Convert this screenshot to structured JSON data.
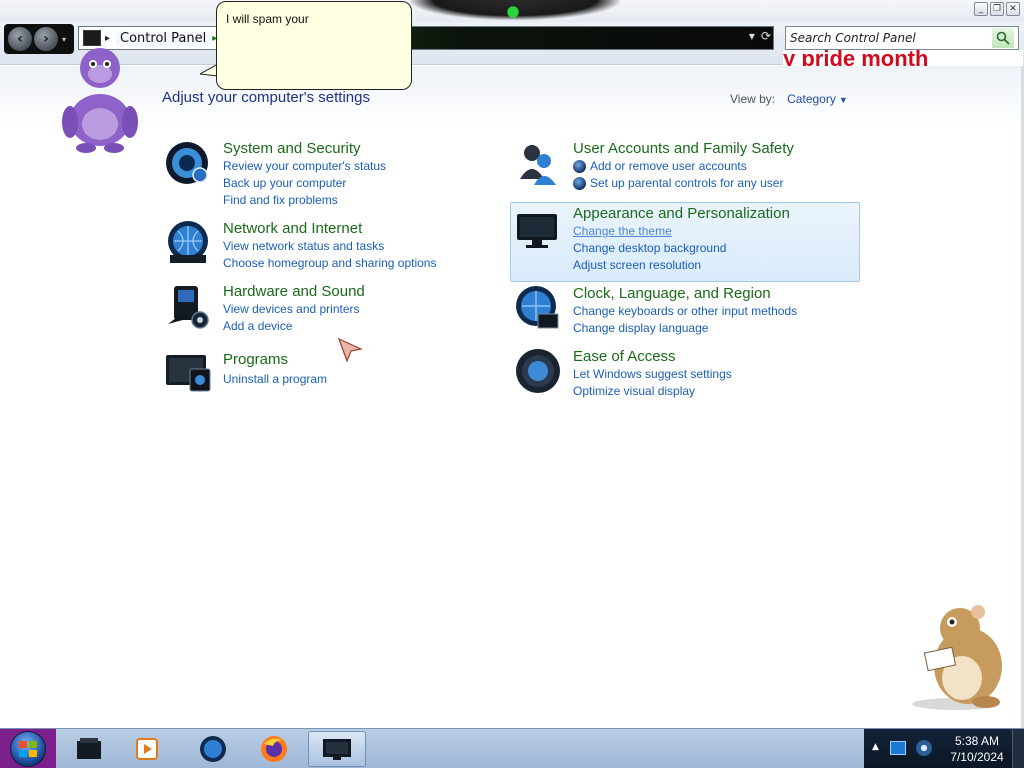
{
  "window": {
    "minimize": "_",
    "restore": "❐",
    "close": "✕"
  },
  "address": {
    "location": "Control Panel",
    "separator": "▸",
    "chevron": "▸"
  },
  "search": {
    "placeholder": "Search Control Panel"
  },
  "banner": {
    "text": "y pride month"
  },
  "page": {
    "title": "Adjust your computer's settings",
    "view_by_label": "View by:",
    "view_by_value": "Category"
  },
  "categories": [
    {
      "title": "System and Security",
      "icon": "system-security-icon",
      "links": [
        "Review your computer's status",
        "Back up your computer",
        "Find and fix problems"
      ]
    },
    {
      "title": "Network and Internet",
      "icon": "network-globe-icon",
      "links": [
        "View network status and tasks",
        "Choose homegroup and sharing options"
      ]
    },
    {
      "title": "Hardware and Sound",
      "icon": "hardware-sound-icon",
      "links": [
        "View devices and printers",
        "Add a device"
      ]
    },
    {
      "title": "Programs",
      "icon": "programs-icon",
      "links": [
        "Uninstall a program"
      ]
    },
    {
      "title": "User Accounts and Family Safety",
      "icon": "user-accounts-icon",
      "links": [
        "Add or remove user accounts",
        "Set up parental controls for any user"
      ]
    },
    {
      "title": "Appearance and Personalization",
      "icon": "monitor-icon",
      "links": [
        "Change the theme",
        "Change desktop background",
        "Adjust screen resolution"
      ]
    },
    {
      "title": "Clock, Language, and Region",
      "icon": "clock-globe-icon",
      "links": [
        "Change keyboards or other input methods",
        "Change display language"
      ]
    },
    {
      "title": "Ease of Access",
      "icon": "ease-of-access-icon",
      "links": [
        "Let Windows suggest settings",
        "Optimize visual display"
      ]
    }
  ],
  "bubble": {
    "text": "I will spam your"
  },
  "taskbar": {
    "items": [
      "windows-explorer-icon",
      "media-player-icon",
      "globe-icon",
      "firefox-icon",
      "control-panel-icon"
    ],
    "time": "5:38 AM",
    "date": "7/10/2024"
  },
  "colors": {
    "title_green": "#1a6b1a",
    "link_blue": "#1a5fb8",
    "heading_blue": "#1e3287",
    "highlight": "#d9ebfa",
    "start_purple": "#7a1f8c",
    "banner_red": "#d10a1e"
  }
}
